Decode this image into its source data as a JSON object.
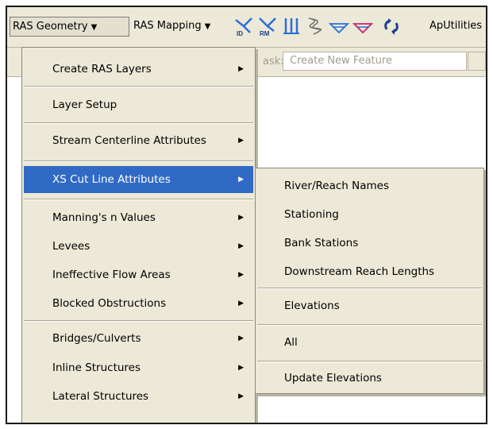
{
  "toolbar": {
    "ras_geometry": "RAS Geometry",
    "ras_mapping": "RAS Mapping",
    "aputilities": "ApUtilities",
    "dropdown_arrow": "▼",
    "icons": [
      "xs-cutline-id-icon",
      "xs-cutline-rm-icon",
      "vertical-lines-icon",
      "flow-path-icon",
      "water-surface-icon",
      "water-surface-red-icon",
      "refresh-icon"
    ]
  },
  "task": {
    "label": "ask:",
    "value": "Create New Feature"
  },
  "menu": {
    "items": [
      {
        "label": "Create RAS Layers",
        "submenu": true
      },
      {
        "label": "Layer Setup",
        "submenu": false
      },
      {
        "label": "Stream Centerline Attributes",
        "submenu": true
      },
      {
        "label": "XS Cut Line Attributes",
        "submenu": true
      },
      {
        "label": "Manning's n Values",
        "submenu": true
      },
      {
        "label": "Levees",
        "submenu": true
      },
      {
        "label": "Ineffective Flow Areas",
        "submenu": true
      },
      {
        "label": "Blocked Obstructions",
        "submenu": true
      },
      {
        "label": "Bridges/Culverts",
        "submenu": true
      },
      {
        "label": "Inline Structures",
        "submenu": true
      },
      {
        "label": "Lateral Structures",
        "submenu": true
      }
    ],
    "submenu_arrow": "▶"
  },
  "submenu": {
    "items": [
      {
        "label": "River/Reach Names"
      },
      {
        "label": "Stationing"
      },
      {
        "label": "Bank Stations"
      },
      {
        "label": "Downstream Reach Lengths"
      },
      {
        "label": "Elevations"
      },
      {
        "label": "All"
      },
      {
        "label": "Update Elevations"
      }
    ]
  },
  "colors": {
    "menu_bg": "#ece9d8",
    "selection": "#316ac5",
    "selection_text": "#ffffff"
  }
}
